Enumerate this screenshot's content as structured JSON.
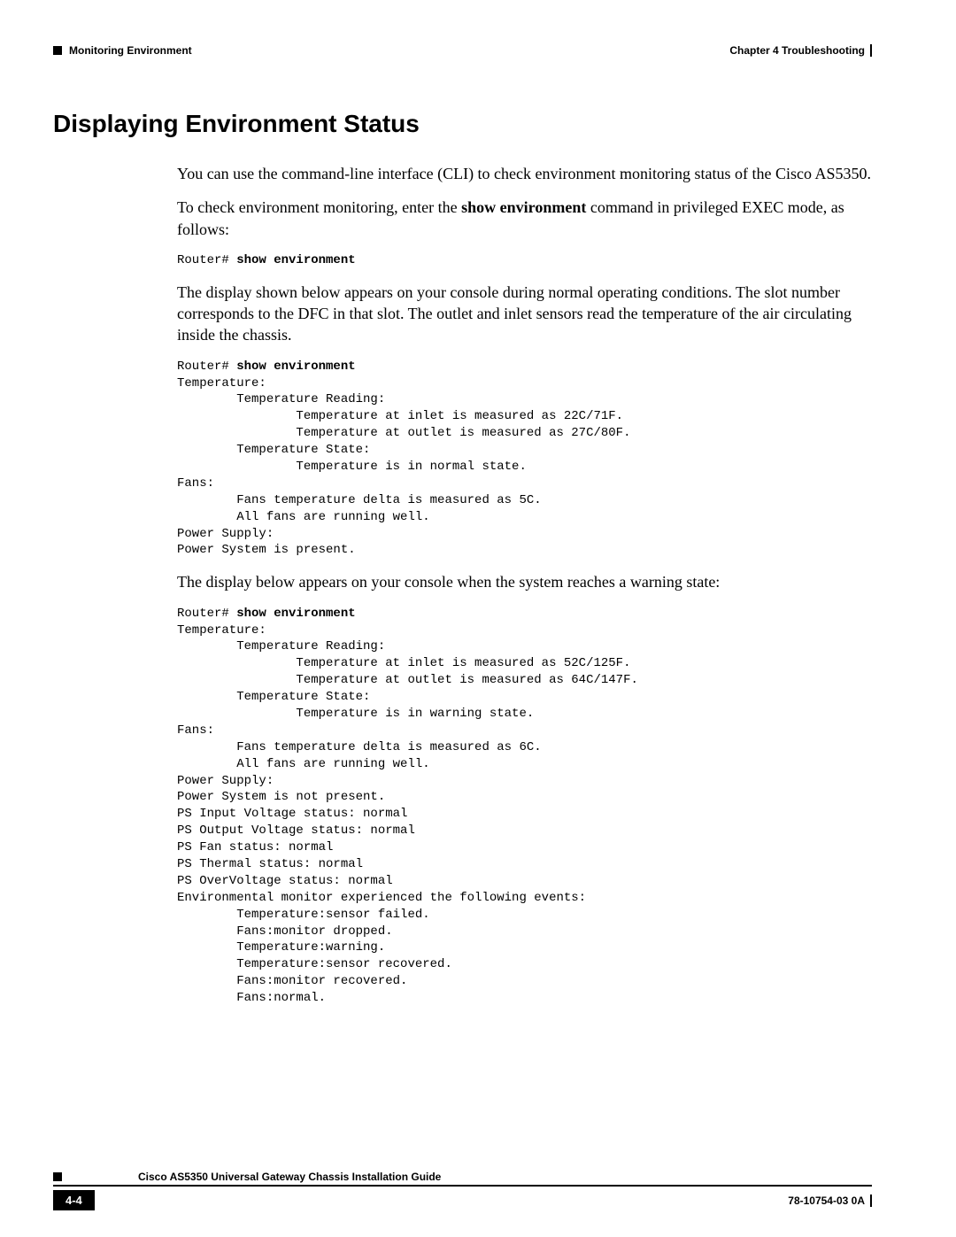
{
  "header": {
    "section": "Monitoring Environment",
    "chapter": "Chapter 4    Troubleshooting"
  },
  "h1": "Displaying Environment Status",
  "p1a": "You can use the command-line interface (CLI) to check environment monitoring status of the Cisco AS5350.",
  "p1b_pre": "To check environment monitoring, enter the ",
  "p1b_cmd": "show environment",
  "p1b_post": " command in privileged EXEC mode, as follows:",
  "code1_prompt": "Router# ",
  "code1_cmd": "show environment",
  "p2": "The display shown below appears on your console during normal operating conditions. The slot number corresponds to the DFC in that slot. The outlet and inlet sensors read the temperature of the air circulating inside the chassis.",
  "code2_prompt": "Router# ",
  "code2_cmd": "show environment",
  "code2_body": "\nTemperature:\n        Temperature Reading:\n                Temperature at inlet is measured as 22C/71F.\n                Temperature at outlet is measured as 27C/80F.\n        Temperature State:\n                Temperature is in normal state.\nFans:\n        Fans temperature delta is measured as 5C.\n        All fans are running well.\nPower Supply:\nPower System is present.",
  "p3": "The display below appears on your console when the system reaches a warning state:",
  "code3_prompt": "Router# ",
  "code3_cmd": "show environment",
  "code3_body": "\nTemperature:\n        Temperature Reading:\n                Temperature at inlet is measured as 52C/125F.\n                Temperature at outlet is measured as 64C/147F.\n        Temperature State:\n                Temperature is in warning state.\nFans:\n        Fans temperature delta is measured as 6C.\n        All fans are running well.\nPower Supply:\nPower System is not present.\nPS Input Voltage status: normal\nPS Output Voltage status: normal\nPS Fan status: normal\nPS Thermal status: normal\nPS OverVoltage status: normal\nEnvironmental monitor experienced the following events:\n        Temperature:sensor failed.\n        Fans:monitor dropped.\n        Temperature:warning.\n        Temperature:sensor recovered.\n        Fans:monitor recovered.\n        Fans:normal.",
  "footer": {
    "guide": "Cisco AS5350 Universal Gateway Chassis Installation Guide",
    "page": "4-4",
    "docid": "78-10754-03 0A"
  }
}
